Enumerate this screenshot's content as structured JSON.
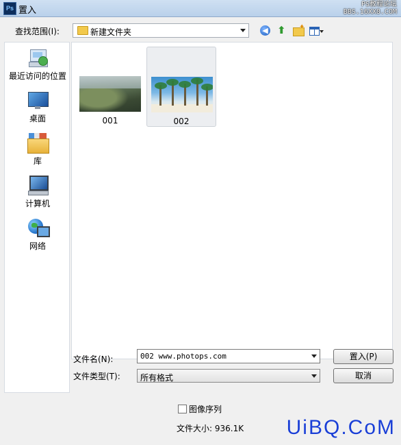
{
  "window": {
    "title": "置入",
    "app_icon": "Ps",
    "watermark_top_line1": "PS教程论坛",
    "watermark_top_line2": "BBS.16XX8.COM"
  },
  "toolbar": {
    "look_in_label": "查找范围(I):",
    "look_in_value": "新建文件夹",
    "icons": [
      "back-icon",
      "up-folder-icon",
      "new-folder-icon",
      "view-menu-icon"
    ]
  },
  "places": [
    {
      "label": "最近访问的位置",
      "icon": "recent-places-icon"
    },
    {
      "label": "桌面",
      "icon": "desktop-icon"
    },
    {
      "label": "库",
      "icon": "libraries-icon"
    },
    {
      "label": "计算机",
      "icon": "computer-icon"
    },
    {
      "label": "网络",
      "icon": "network-icon"
    }
  ],
  "files": [
    {
      "name": "001",
      "selected": false
    },
    {
      "name": "002",
      "selected": true
    }
  ],
  "form": {
    "filename_label": "文件名(N):",
    "filename_value": "002 www.photops.com",
    "filetype_label": "文件类型(T):",
    "filetype_value": "所有格式",
    "place_button": "置入(P)",
    "cancel_button": "取消",
    "image_sequence_label": "图像序列",
    "image_sequence_checked": false,
    "filesize_text": "文件大小: 936.1K"
  },
  "watermark_bottom": "UiBQ.CoM"
}
